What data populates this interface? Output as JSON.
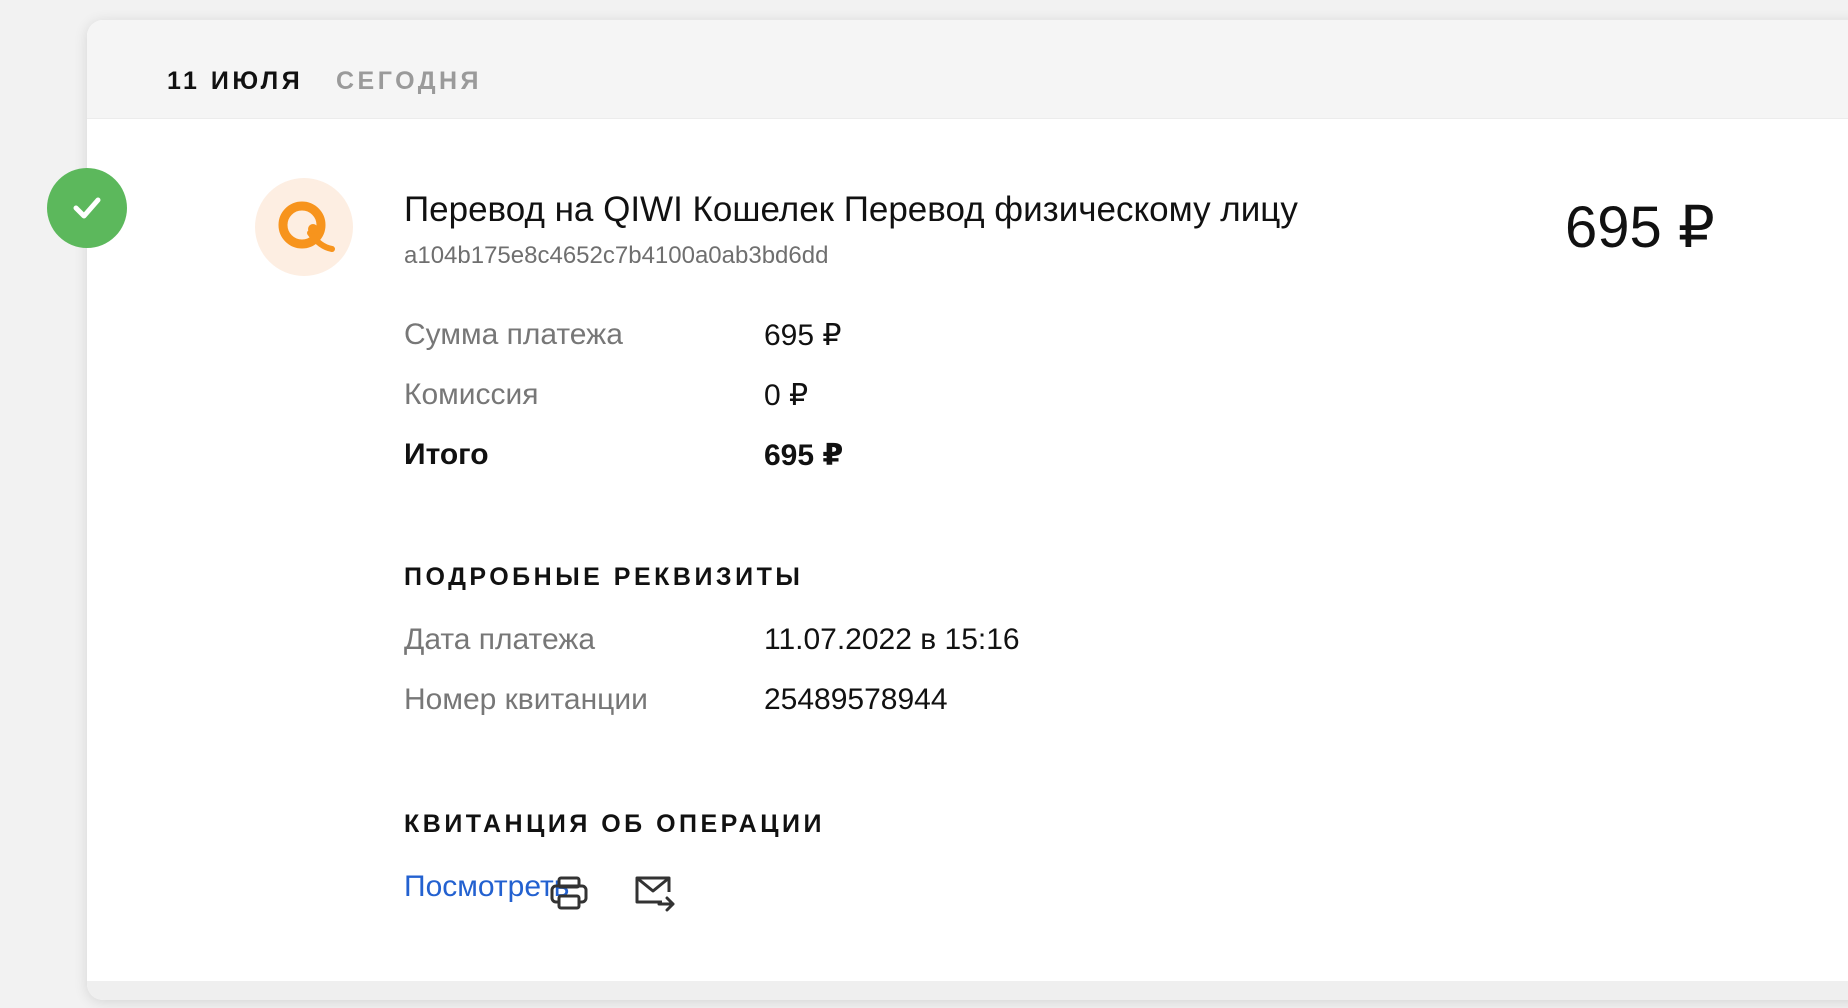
{
  "header": {
    "date": "11 ИЮЛЯ",
    "relative_day": "СЕГОДНЯ"
  },
  "payment": {
    "status_icon": "checkmark-icon",
    "provider_icon": "qiwi-logo",
    "title": "Перевод на QIWI Кошелек Перевод физическому лицу",
    "transaction_id": "a104b175e8c4652c7b4100a0ab3bd6dd",
    "amount": "695 ₽",
    "summary": {
      "sum_label": "Сумма платежа",
      "sum_value": "695 ₽",
      "commission_label": "Комиссия",
      "commission_value": "0 ₽",
      "total_label": "Итого",
      "total_value": "695 ₽"
    }
  },
  "details": {
    "title": "ПОДРОБНЫЕ РЕКВИЗИТЫ",
    "date_label": "Дата платежа",
    "date_value": "11.07.2022 в 15:16",
    "receipt_label": "Номер квитанции",
    "receipt_value": "25489578944"
  },
  "receipt": {
    "title": "КВИТАНЦИЯ ОБ ОПЕРАЦИИ",
    "view_label": "Посмотреть",
    "print_icon": "printer-icon",
    "email_icon": "mail-forward-icon"
  },
  "colors": {
    "success": "#5cb85c",
    "qiwi_orange": "#f7941d",
    "link": "#2361d0"
  }
}
